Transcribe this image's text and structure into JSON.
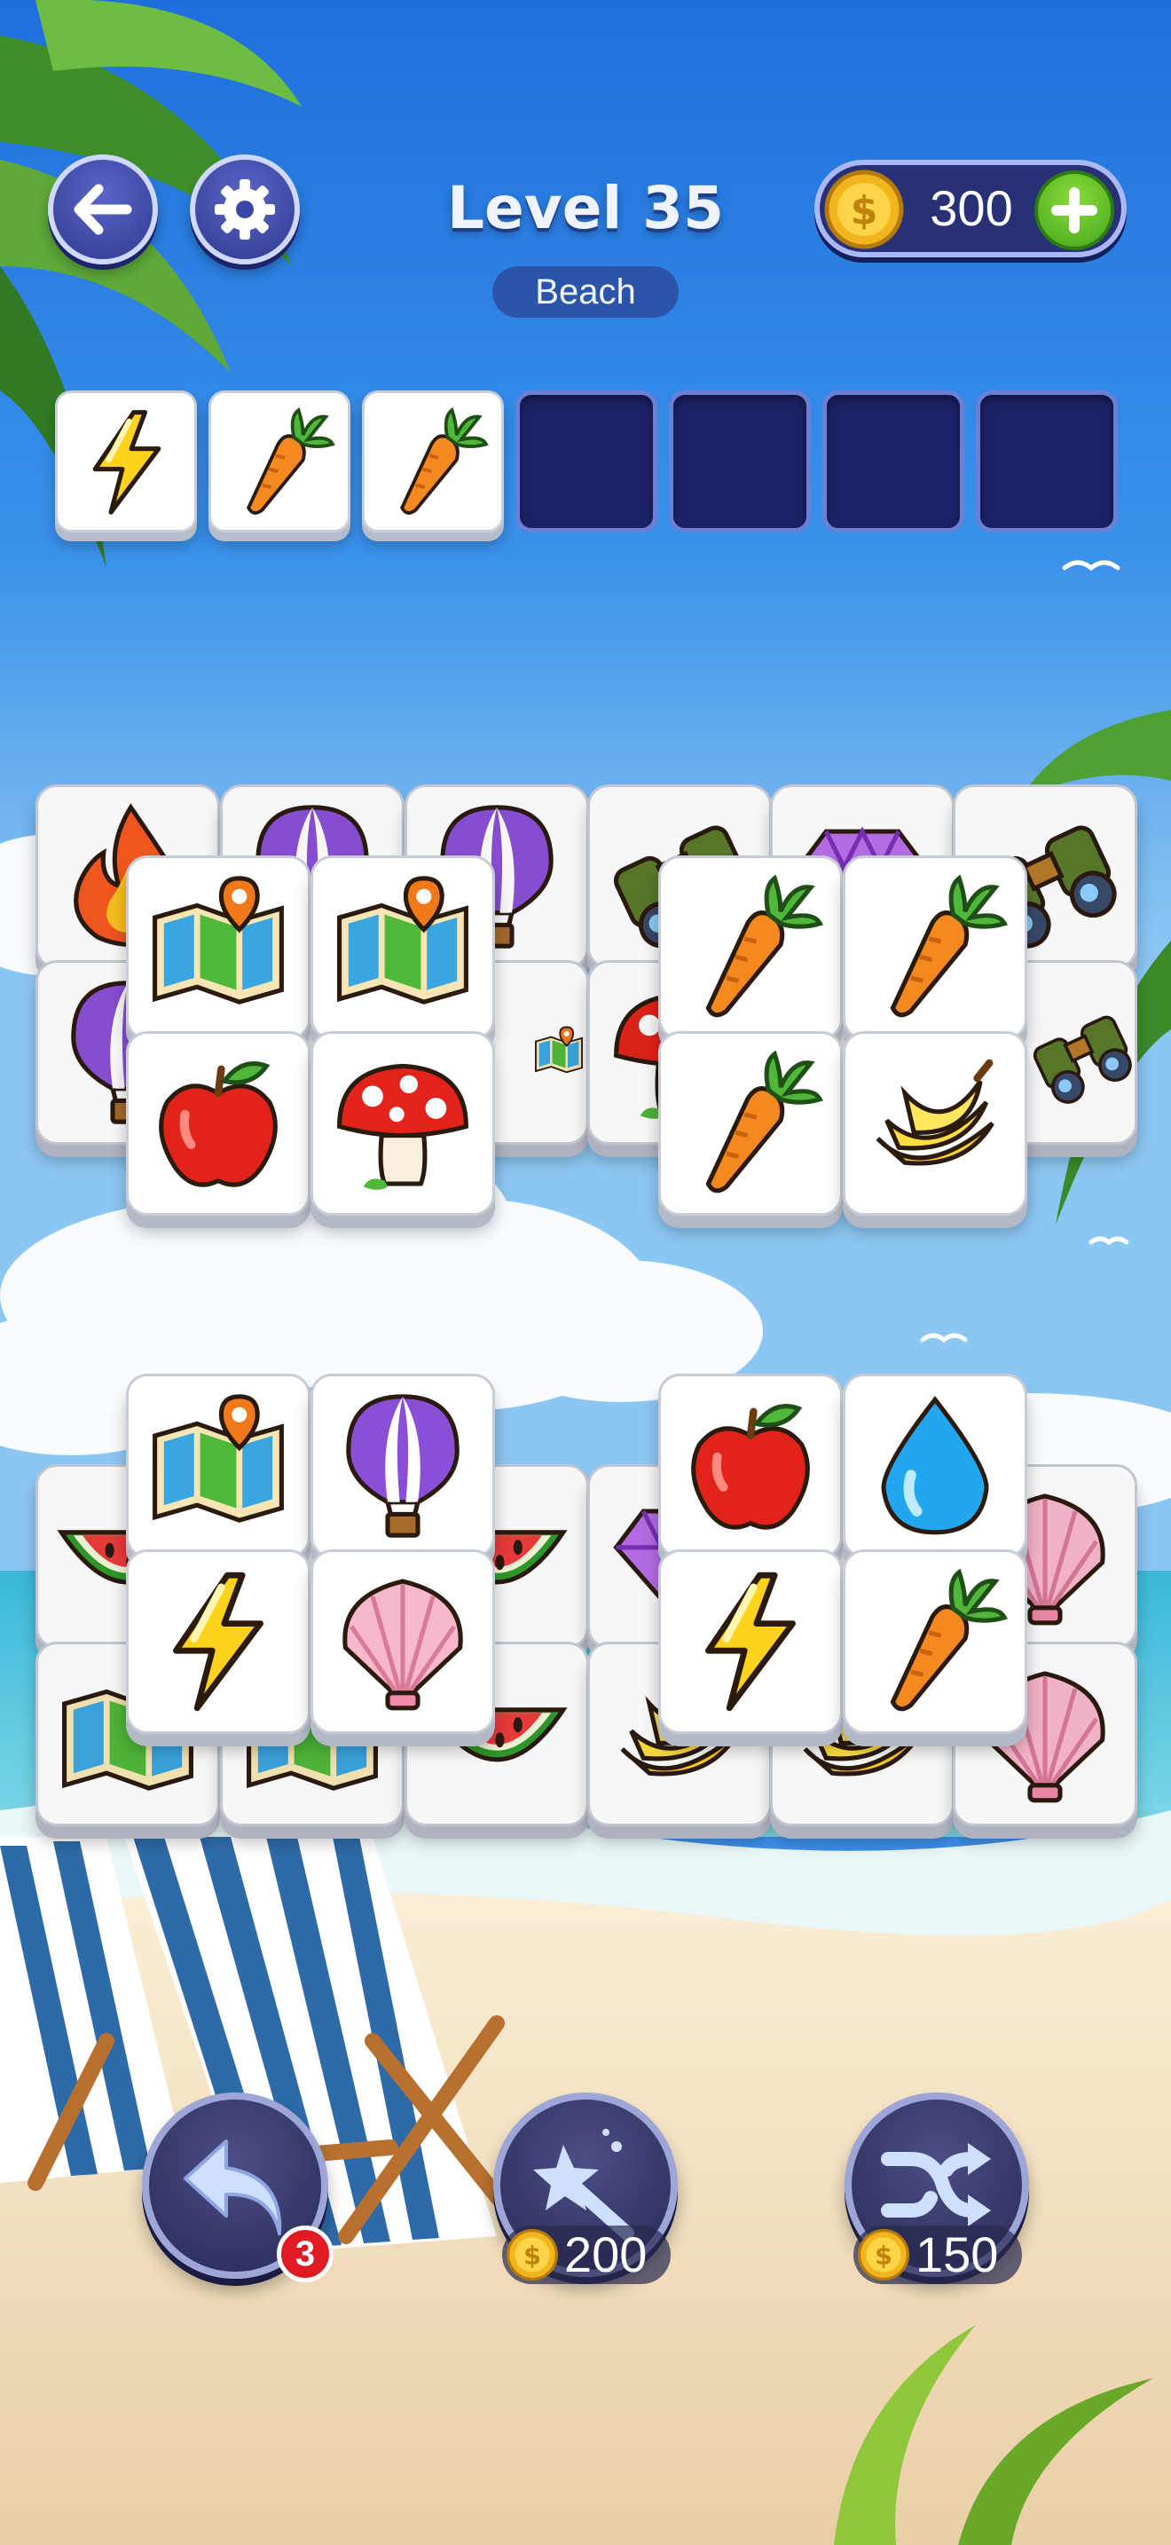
{
  "header": {
    "back_icon": "arrow-left-icon",
    "settings_icon": "gear-icon",
    "level_title": "Level 35",
    "level_theme": "Beach",
    "coins": "300",
    "add_coins_icon": "plus-icon"
  },
  "tray": {
    "capacity": 7,
    "slots": [
      "lightning",
      "carrot",
      "carrot",
      "",
      "",
      "",
      ""
    ]
  },
  "board": {
    "top_group": {
      "back_row_1": [
        "fire",
        "balloon",
        "balloon",
        "binoculars",
        "gem",
        "binoculars"
      ],
      "back_row_2": [
        "balloon",
        "",
        "map",
        "mushroom",
        "",
        "binoculars"
      ],
      "front_left": [
        "map",
        "map",
        "apple",
        "mushroom"
      ],
      "front_right": [
        "carrot",
        "carrot",
        "carrot",
        "banana"
      ]
    },
    "bottom_group": {
      "back_row_1": [
        "watermelon",
        "",
        "watermelon",
        "gem",
        "",
        "shell"
      ],
      "back_row_2": [
        "map",
        "map",
        "watermelon",
        "banana",
        "banana",
        "shell"
      ],
      "front_left": [
        "map",
        "balloon",
        "lightning",
        "shell"
      ],
      "front_right": [
        "apple",
        "water-drop",
        "lightning",
        "carrot"
      ]
    }
  },
  "boosters": {
    "undo": {
      "icon": "undo-arrow-icon",
      "count": "3"
    },
    "magic": {
      "icon": "magic-wand-icon",
      "price": "200"
    },
    "shuffle": {
      "icon": "shuffle-icon",
      "price": "150"
    }
  },
  "colors": {
    "sky_top": "#2a78e0",
    "sea": "#2ab6d6",
    "sand": "#f3e3c4",
    "button_blue": "#2f3a8f",
    "tile_white": "#ffffff",
    "slot_empty": "#1c2266"
  }
}
